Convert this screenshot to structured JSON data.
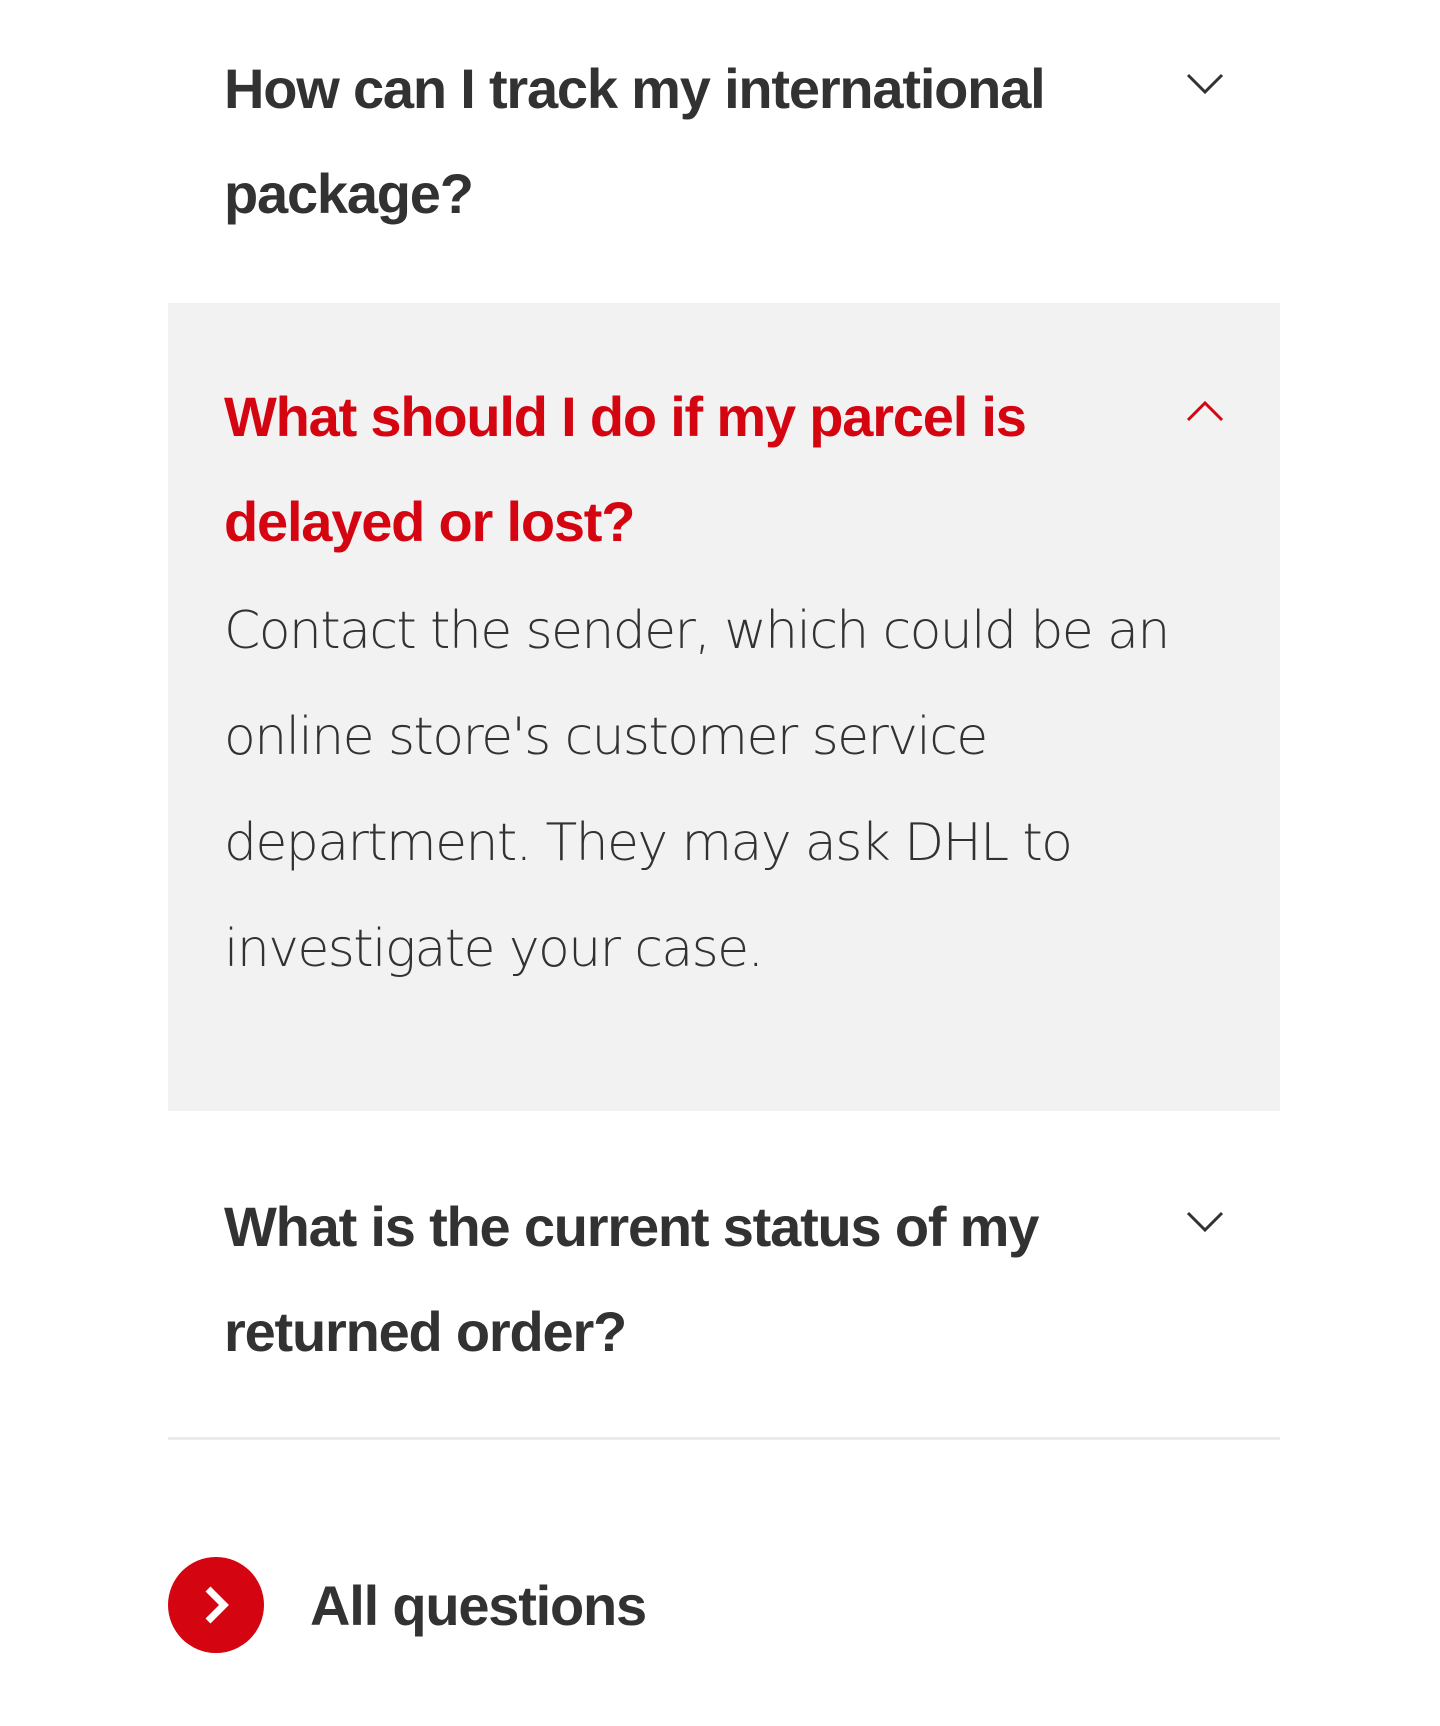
{
  "faq": {
    "items": [
      {
        "question": "How can I track my international package?",
        "expanded": false,
        "icon": "chevron-down-icon"
      },
      {
        "question": "What should I do if my parcel is delayed or lost?",
        "answer": "Contact the sender, which could be an online store's customer service department. They may ask DHL to investigate your case.",
        "expanded": true,
        "icon": "chevron-up-icon"
      },
      {
        "question": "What is the current status of my returned order?",
        "expanded": false,
        "icon": "chevron-down-icon"
      }
    ]
  },
  "all_questions": {
    "label": "All questions",
    "icon": "chevron-right-icon"
  },
  "colors": {
    "accent": "#d40511",
    "text": "#323232",
    "expanded_background": "#f2f2f2",
    "divider": "#ebebeb"
  }
}
